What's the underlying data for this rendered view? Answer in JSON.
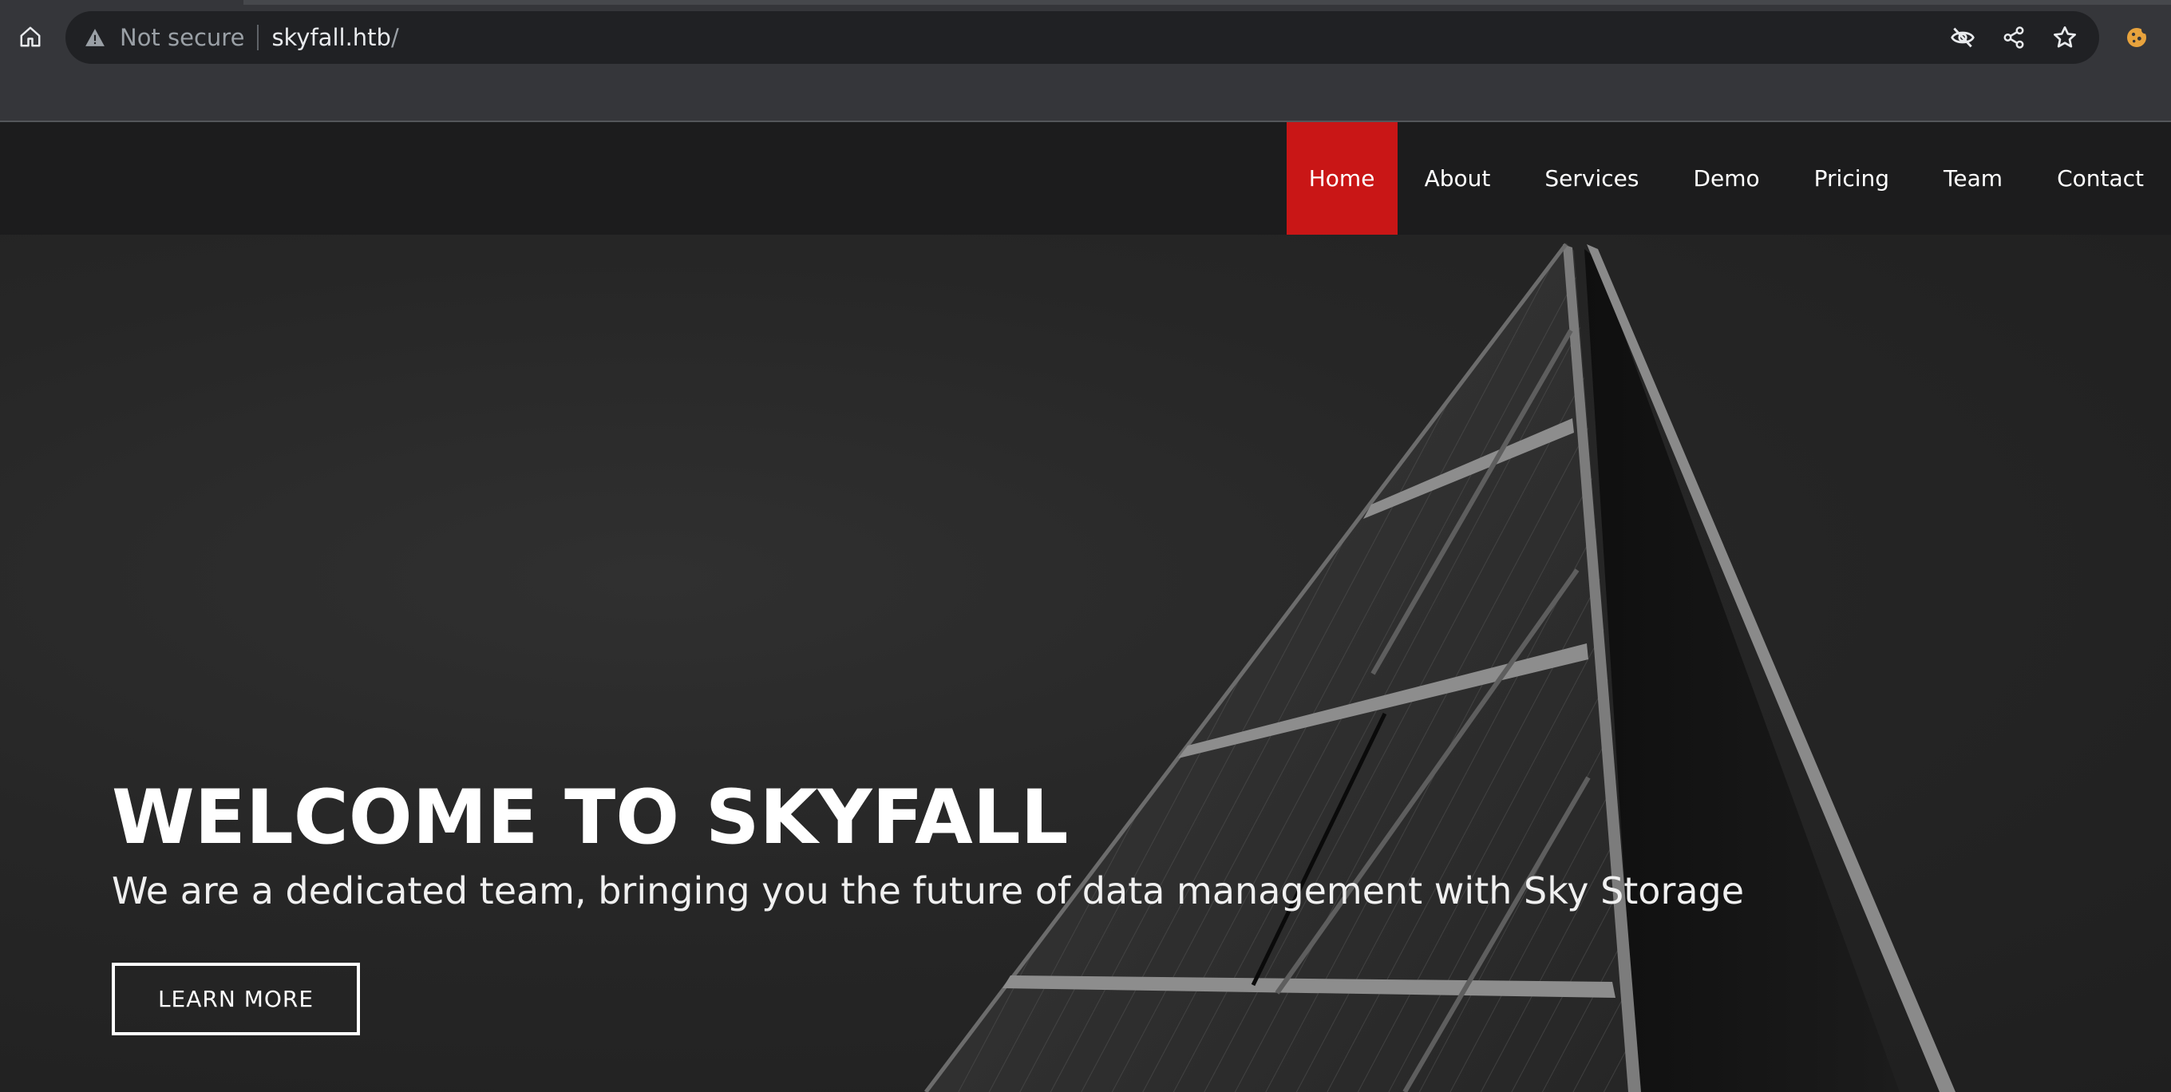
{
  "browser": {
    "security_label": "Not secure",
    "url_host": "skyfall.htb",
    "url_path": "/",
    "icons": {
      "home": "home-icon",
      "warning": "warning-triangle-icon",
      "tracking": "eye-off-icon",
      "share": "share-icon",
      "bookmark": "star-icon",
      "extension": "cookie-extension-icon"
    },
    "colors": {
      "chrome": "#35363a",
      "omnibox": "#202124",
      "extension_accent": "#e8a33d"
    }
  },
  "nav": {
    "items": [
      {
        "label": "Home",
        "active": true
      },
      {
        "label": "About",
        "active": false
      },
      {
        "label": "Services",
        "active": false
      },
      {
        "label": "Demo",
        "active": false
      },
      {
        "label": "Pricing",
        "active": false
      },
      {
        "label": "Team",
        "active": false
      },
      {
        "label": "Contact",
        "active": false
      }
    ],
    "active_color": "#c91616"
  },
  "hero": {
    "title": "WELCOME TO SKYFALL",
    "subtitle": "We are a dedicated team, bringing you the future of data management with Sky Storage",
    "cta_label": "LEARN MORE"
  }
}
